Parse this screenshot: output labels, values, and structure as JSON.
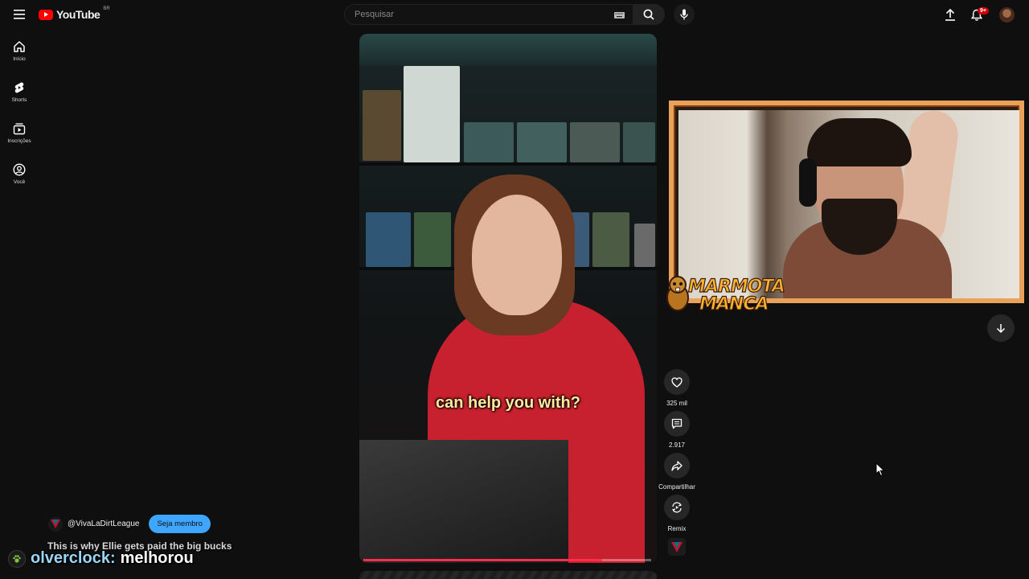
{
  "header": {
    "brand": "YouTube",
    "country_code": "BR",
    "search": {
      "placeholder": "Pesquisar",
      "value": ""
    },
    "notifications_count": "9+"
  },
  "sidebar": {
    "items": [
      {
        "label": "Início",
        "icon": "home-icon"
      },
      {
        "label": "Shorts",
        "icon": "shorts-icon"
      },
      {
        "label": "Inscrições",
        "icon": "subscriptions-icon"
      },
      {
        "label": "Você",
        "icon": "you-icon"
      }
    ]
  },
  "short": {
    "caption": "can help you with?",
    "progress": 0.83,
    "channel_handle": "@VivaLaDirtLeague",
    "join_label": "Seja membro",
    "title": "This is why Ellie gets paid the big bucks"
  },
  "actions": {
    "likes": "325 mil",
    "comments": "2.917",
    "share_label": "Compartilhar",
    "remix_label": "Remix"
  },
  "stream_overlay": {
    "brand_line1": "MARMOTA",
    "brand_line2": "MANCA",
    "chat_user": "olverclock:",
    "chat_message": "melhorou"
  },
  "colors": {
    "accent_red": "#ff0000",
    "progress": "#ff2e4d",
    "join_button": "#3ea6ff",
    "webcam_border": "#e8a25a"
  }
}
